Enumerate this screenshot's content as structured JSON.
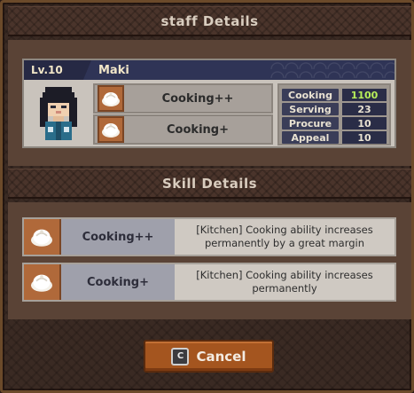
{
  "staff_header": {
    "title": "staff Details"
  },
  "staff": {
    "level": "Lv.10",
    "name": "Maki",
    "skills": [
      {
        "label": "Cooking++",
        "icon": "steamed-bun-icon"
      },
      {
        "label": "Cooking+",
        "icon": "steamed-bun-icon"
      }
    ],
    "stats": [
      {
        "name": "Cooking",
        "value": "1100",
        "highlight": true
      },
      {
        "name": "Serving",
        "value": "23",
        "highlight": false
      },
      {
        "name": "Procure",
        "value": "10",
        "highlight": false
      },
      {
        "name": "Appeal",
        "value": "10",
        "highlight": false
      }
    ]
  },
  "skill_header": {
    "title": "Skill Details"
  },
  "skill_details": [
    {
      "name": "Cooking++",
      "description": "[Kitchen] Cooking ability increases permanently by a great margin",
      "icon": "steamed-bun-icon"
    },
    {
      "name": "Cooking+",
      "description": "[Kitchen] Cooking ability increases permanently",
      "icon": "steamed-bun-icon"
    }
  ],
  "cancel_button": {
    "key": "C",
    "label": "Cancel"
  },
  "colors": {
    "frame": "#3a2a23",
    "accent_orange": "#a4551f",
    "card_navy": "#2f3456",
    "stat_highlight": "#b9f05a"
  }
}
